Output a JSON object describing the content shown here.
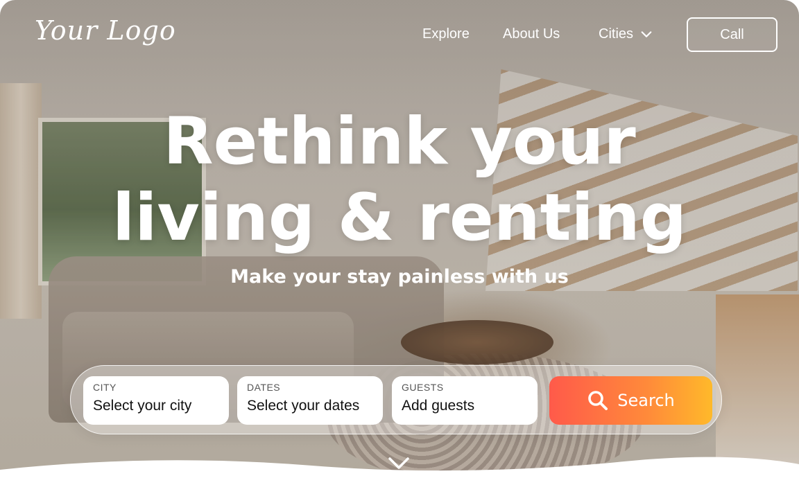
{
  "header": {
    "logo_text": "Your Logo",
    "nav": [
      {
        "label": "Explore"
      },
      {
        "label": "About Us"
      },
      {
        "label": "Cities",
        "icon": "chevron-down-icon"
      }
    ],
    "call_label": "Call"
  },
  "hero": {
    "headline_line1": "Rethink your",
    "headline_line2": "living & renting",
    "subheadline": "Make your stay painless with us"
  },
  "search": {
    "city": {
      "label": "CITY",
      "value": "Select your city"
    },
    "dates": {
      "label": "DATES",
      "value": "Select your dates"
    },
    "guests": {
      "label": "GUESTS",
      "value": "Add guests"
    },
    "button_label": "Search",
    "button_icon": "search-icon"
  },
  "scroll_icon": "chevron-down-icon",
  "colors": {
    "search_gradient_start": "#ff5a4a",
    "search_gradient_end": "#ffb92a",
    "text_light": "#ffffff"
  }
}
